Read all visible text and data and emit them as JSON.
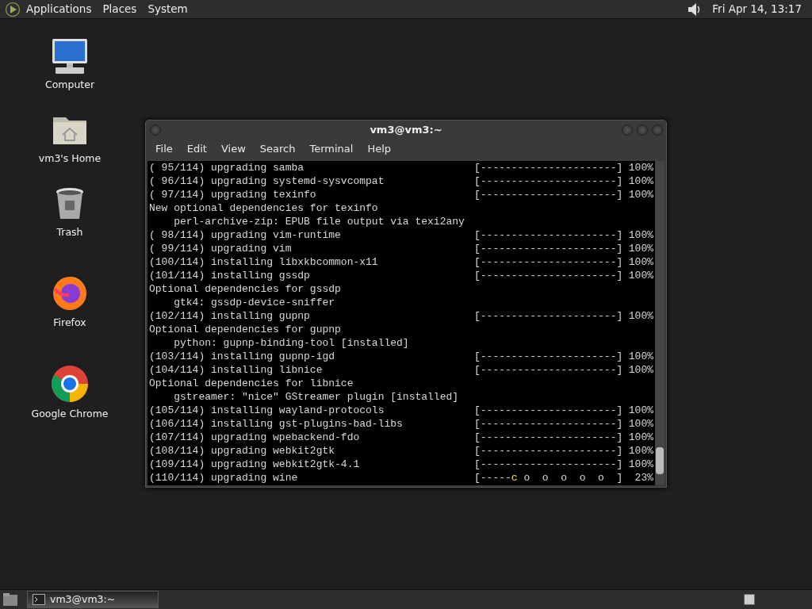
{
  "top_panel": {
    "menus": [
      "Applications",
      "Places",
      "System"
    ],
    "clock": "Fri Apr 14, 13:17"
  },
  "desktop_icons": [
    {
      "kind": "computer",
      "label": "Computer"
    },
    {
      "kind": "home",
      "label": "vm3's Home"
    },
    {
      "kind": "trash",
      "label": "Trash"
    },
    {
      "kind": "firefox",
      "label": "Firefox"
    },
    {
      "kind": "chrome",
      "label": "Google Chrome"
    }
  ],
  "terminal": {
    "title": "vm3@vm3:~",
    "menu": [
      "File",
      "Edit",
      "View",
      "Search",
      "Terminal",
      "Help"
    ],
    "lines": [
      {
        "kind": "progress",
        "text": "( 95/114) upgrading samba",
        "bar": "[----------------------]",
        "percent": "100%"
      },
      {
        "kind": "progress",
        "text": "( 96/114) upgrading systemd-sysvcompat",
        "bar": "[----------------------]",
        "percent": "100%"
      },
      {
        "kind": "progress",
        "text": "( 97/114) upgrading texinfo",
        "bar": "[----------------------]",
        "percent": "100%"
      },
      {
        "kind": "text",
        "text": "New optional dependencies for texinfo"
      },
      {
        "kind": "text",
        "text": "    perl-archive-zip: EPUB file output via texi2any"
      },
      {
        "kind": "progress",
        "text": "( 98/114) upgrading vim-runtime",
        "bar": "[----------------------]",
        "percent": "100%"
      },
      {
        "kind": "progress",
        "text": "( 99/114) upgrading vim",
        "bar": "[----------------------]",
        "percent": "100%"
      },
      {
        "kind": "progress",
        "text": "(100/114) installing libxkbcommon-x11",
        "bar": "[----------------------]",
        "percent": "100%"
      },
      {
        "kind": "progress",
        "text": "(101/114) installing gssdp",
        "bar": "[----------------------]",
        "percent": "100%"
      },
      {
        "kind": "text",
        "text": "Optional dependencies for gssdp"
      },
      {
        "kind": "text",
        "text": "    gtk4: gssdp-device-sniffer"
      },
      {
        "kind": "progress",
        "text": "(102/114) installing gupnp",
        "bar": "[----------------------]",
        "percent": "100%"
      },
      {
        "kind": "text",
        "text": "Optional dependencies for gupnp"
      },
      {
        "kind": "text",
        "text": "    python: gupnp-binding-tool [installed]"
      },
      {
        "kind": "progress",
        "text": "(103/114) installing gupnp-igd",
        "bar": "[----------------------]",
        "percent": "100%"
      },
      {
        "kind": "progress",
        "text": "(104/114) installing libnice",
        "bar": "[----------------------]",
        "percent": "100%"
      },
      {
        "kind": "text",
        "text": "Optional dependencies for libnice"
      },
      {
        "kind": "text",
        "text": "    gstreamer: \"nice\" GStreamer plugin [installed]"
      },
      {
        "kind": "progress",
        "text": "(105/114) installing wayland-protocols",
        "bar": "[----------------------]",
        "percent": "100%"
      },
      {
        "kind": "progress",
        "text": "(106/114) installing gst-plugins-bad-libs",
        "bar": "[----------------------]",
        "percent": "100%"
      },
      {
        "kind": "progress",
        "text": "(107/114) upgrading wpebackend-fdo",
        "bar": "[----------------------]",
        "percent": "100%"
      },
      {
        "kind": "progress",
        "text": "(108/114) upgrading webkit2gtk",
        "bar": "[----------------------]",
        "percent": "100%"
      },
      {
        "kind": "progress",
        "text": "(109/114) upgrading webkit2gtk-4.1",
        "bar": "[----------------------]",
        "percent": "100%"
      },
      {
        "kind": "pacman",
        "text": "(110/114) upgrading wine",
        "bar_done": "[-----",
        "pacman": "c",
        "bar_rest": " o  o  o  o  o  ]",
        "percent": "23%"
      }
    ]
  },
  "taskbar": {
    "tasks": [
      {
        "label": "vm3@vm3:~",
        "selected": true
      }
    ]
  }
}
